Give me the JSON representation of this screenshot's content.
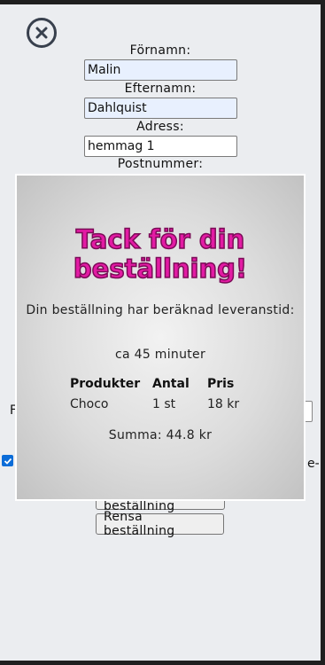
{
  "form": {
    "firstname_label": "Förnamn:",
    "firstname_value": "Malin",
    "lastname_label": "Efternamn:",
    "lastname_value": "Dahlquist",
    "address_label": "Adress:",
    "address_value": "hemmag 1",
    "postcode_label": "Postnummer:",
    "partial_left_text": "F",
    "partial_right_text": "e-",
    "terms_checked": true
  },
  "buttons": {
    "send": "Skicka beställning",
    "clear": "Rensa beställning"
  },
  "modal": {
    "title": "Tack för din beställning!",
    "message": "Din beställning har beräknad leveranstid:",
    "eta": "ca 45 minuter",
    "table": {
      "headers": [
        "Produkter",
        "Antal",
        "Pris"
      ],
      "rows": [
        [
          "Choco",
          "1 st",
          "18 kr"
        ]
      ]
    },
    "sum": "Summa: 44.8 kr"
  },
  "colors": {
    "title_pink": "#e31ba4",
    "title_outline": "#7a0b56",
    "page_bg": "#ebedf0",
    "close_icon": "#38404d",
    "checkbox_blue": "#0a6cd8"
  }
}
